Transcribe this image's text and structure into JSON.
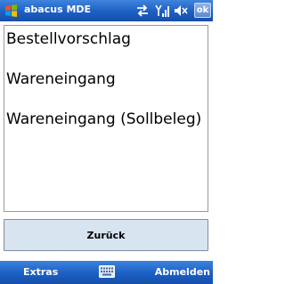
{
  "titlebar": {
    "app_title": "abacus MDE",
    "ok_label": "ok",
    "icons": [
      "windows-start-icon",
      "connectivity-arrows-icon",
      "signal-strength-icon",
      "volume-icon"
    ]
  },
  "list": {
    "items": [
      {
        "label": "Bestellvorschlag"
      },
      {
        "label": "Wareneingang"
      },
      {
        "label": "Wareneingang (Sollbeleg)"
      }
    ]
  },
  "buttons": {
    "back_label": "Zurück"
  },
  "softkeys": {
    "left_label": "Extras",
    "right_label": "Abmelden",
    "center_icon": "keyboard-icon"
  },
  "colors": {
    "titlebar": "#1c5fc4",
    "button_bg": "#d9e4f1",
    "list_border": "#9a9a9a"
  }
}
